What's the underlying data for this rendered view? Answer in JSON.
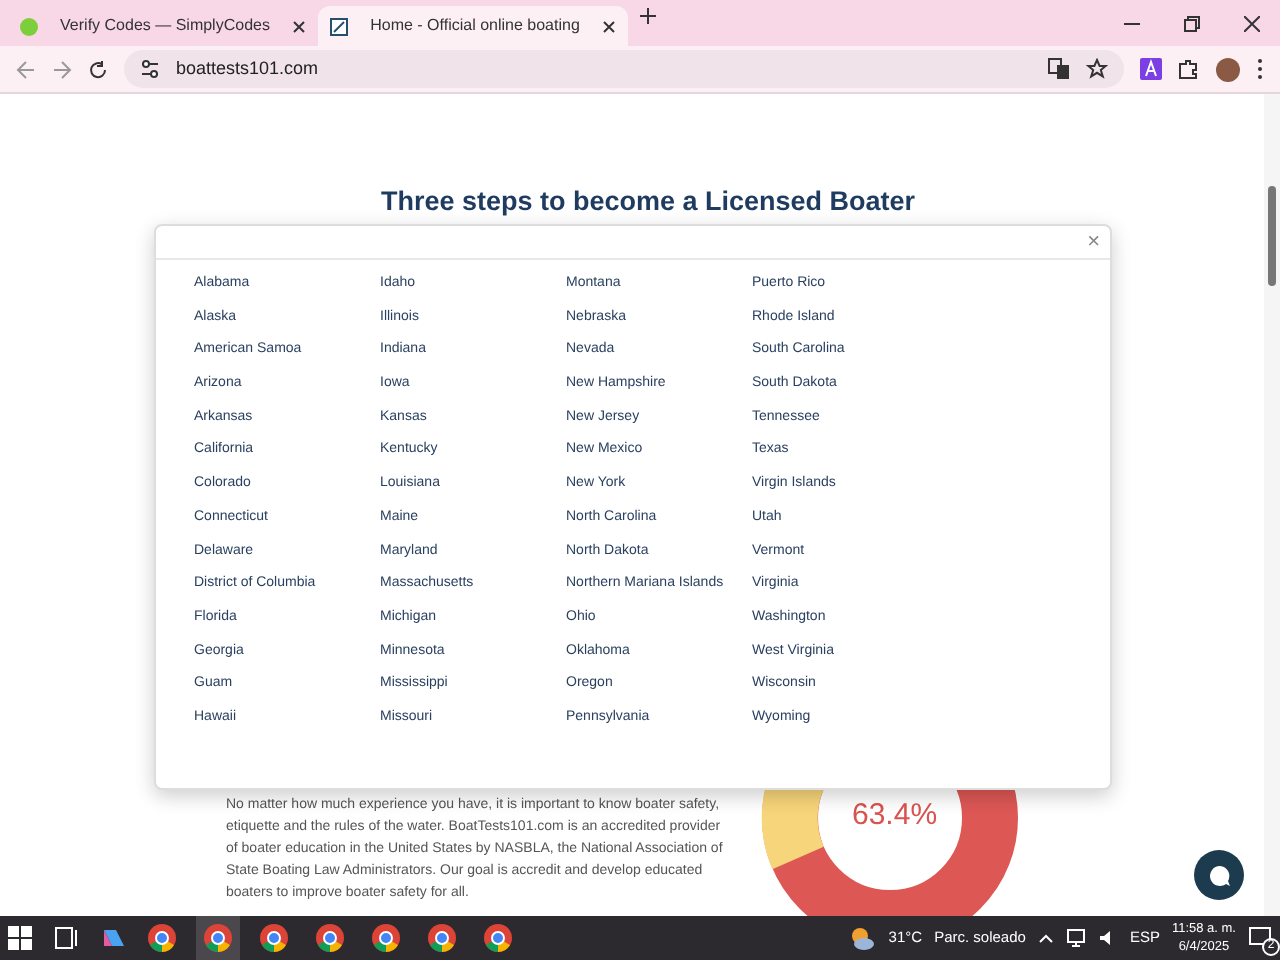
{
  "browser": {
    "tabs": [
      {
        "title": "Verify Codes — SimplyCodes",
        "selected": false
      },
      {
        "title": "Home - Official online boating",
        "selected": true
      }
    ],
    "url": "boattests101.com"
  },
  "page": {
    "heading": "Three steps to become a Licensed Boater",
    "paragraph": "No matter how much experience you have, it is important to know boater safety, etiquette and the rules of the water. BoatTests101.com is an accredited provider of boater education in the United States by NASBLA, the National Association of State Boating Law Administrators. Our goal is accredit and develop educated boaters to improve boater safety for all.",
    "donut_label": "63.4%"
  },
  "modal": {
    "close": "×",
    "columns": [
      [
        "Alabama",
        "Alaska",
        "American Samoa",
        "Arizona",
        "Arkansas",
        "California",
        "Colorado",
        "Connecticut",
        "Delaware",
        "District of Columbia",
        "Florida",
        "Georgia",
        "Guam",
        "Hawaii"
      ],
      [
        "Idaho",
        "Illinois",
        "Indiana",
        "Iowa",
        "Kansas",
        "Kentucky",
        "Louisiana",
        "Maine",
        "Maryland",
        "Massachusetts",
        "Michigan",
        "Minnesota",
        "Mississippi",
        "Missouri"
      ],
      [
        "Montana",
        "Nebraska",
        "Nevada",
        "New Hampshire",
        "New Jersey",
        "New Mexico",
        "New York",
        "North Carolina",
        "North Dakota",
        "Northern Mariana Islands",
        "Ohio",
        "Oklahoma",
        "Oregon",
        "Pennsylvania"
      ],
      [
        "Puerto Rico",
        "Rhode Island",
        "South Carolina",
        "South Dakota",
        "Tennessee",
        "Texas",
        "Virgin Islands",
        "Utah",
        "Vermont",
        "Virginia",
        "Washington",
        "West Virginia",
        "Wisconsin",
        "Wyoming"
      ]
    ]
  },
  "taskbar": {
    "temperature": "31°C",
    "weather": "Parc. soleado",
    "language": "ESP",
    "time": "11:58 a. m.",
    "date": "6/4/2025",
    "notifications": "2"
  }
}
